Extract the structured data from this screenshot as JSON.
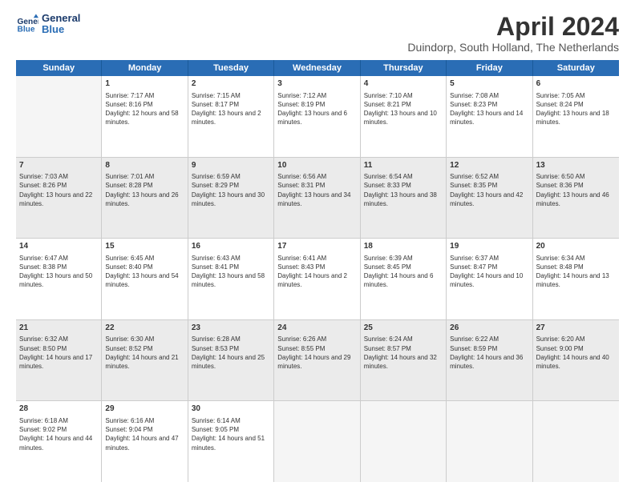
{
  "header": {
    "logo_line1": "General",
    "logo_line2": "Blue",
    "title": "April 2024",
    "subtitle": "Duindorp, South Holland, The Netherlands"
  },
  "calendar": {
    "days_of_week": [
      "Sunday",
      "Monday",
      "Tuesday",
      "Wednesday",
      "Thursday",
      "Friday",
      "Saturday"
    ],
    "weeks": [
      [
        {
          "day": "",
          "sunrise": "",
          "sunset": "",
          "daylight": ""
        },
        {
          "day": "1",
          "sunrise": "Sunrise: 7:17 AM",
          "sunset": "Sunset: 8:16 PM",
          "daylight": "Daylight: 12 hours and 58 minutes."
        },
        {
          "day": "2",
          "sunrise": "Sunrise: 7:15 AM",
          "sunset": "Sunset: 8:17 PM",
          "daylight": "Daylight: 13 hours and 2 minutes."
        },
        {
          "day": "3",
          "sunrise": "Sunrise: 7:12 AM",
          "sunset": "Sunset: 8:19 PM",
          "daylight": "Daylight: 13 hours and 6 minutes."
        },
        {
          "day": "4",
          "sunrise": "Sunrise: 7:10 AM",
          "sunset": "Sunset: 8:21 PM",
          "daylight": "Daylight: 13 hours and 10 minutes."
        },
        {
          "day": "5",
          "sunrise": "Sunrise: 7:08 AM",
          "sunset": "Sunset: 8:23 PM",
          "daylight": "Daylight: 13 hours and 14 minutes."
        },
        {
          "day": "6",
          "sunrise": "Sunrise: 7:05 AM",
          "sunset": "Sunset: 8:24 PM",
          "daylight": "Daylight: 13 hours and 18 minutes."
        }
      ],
      [
        {
          "day": "7",
          "sunrise": "Sunrise: 7:03 AM",
          "sunset": "Sunset: 8:26 PM",
          "daylight": "Daylight: 13 hours and 22 minutes."
        },
        {
          "day": "8",
          "sunrise": "Sunrise: 7:01 AM",
          "sunset": "Sunset: 8:28 PM",
          "daylight": "Daylight: 13 hours and 26 minutes."
        },
        {
          "day": "9",
          "sunrise": "Sunrise: 6:59 AM",
          "sunset": "Sunset: 8:29 PM",
          "daylight": "Daylight: 13 hours and 30 minutes."
        },
        {
          "day": "10",
          "sunrise": "Sunrise: 6:56 AM",
          "sunset": "Sunset: 8:31 PM",
          "daylight": "Daylight: 13 hours and 34 minutes."
        },
        {
          "day": "11",
          "sunrise": "Sunrise: 6:54 AM",
          "sunset": "Sunset: 8:33 PM",
          "daylight": "Daylight: 13 hours and 38 minutes."
        },
        {
          "day": "12",
          "sunrise": "Sunrise: 6:52 AM",
          "sunset": "Sunset: 8:35 PM",
          "daylight": "Daylight: 13 hours and 42 minutes."
        },
        {
          "day": "13",
          "sunrise": "Sunrise: 6:50 AM",
          "sunset": "Sunset: 8:36 PM",
          "daylight": "Daylight: 13 hours and 46 minutes."
        }
      ],
      [
        {
          "day": "14",
          "sunrise": "Sunrise: 6:47 AM",
          "sunset": "Sunset: 8:38 PM",
          "daylight": "Daylight: 13 hours and 50 minutes."
        },
        {
          "day": "15",
          "sunrise": "Sunrise: 6:45 AM",
          "sunset": "Sunset: 8:40 PM",
          "daylight": "Daylight: 13 hours and 54 minutes."
        },
        {
          "day": "16",
          "sunrise": "Sunrise: 6:43 AM",
          "sunset": "Sunset: 8:41 PM",
          "daylight": "Daylight: 13 hours and 58 minutes."
        },
        {
          "day": "17",
          "sunrise": "Sunrise: 6:41 AM",
          "sunset": "Sunset: 8:43 PM",
          "daylight": "Daylight: 14 hours and 2 minutes."
        },
        {
          "day": "18",
          "sunrise": "Sunrise: 6:39 AM",
          "sunset": "Sunset: 8:45 PM",
          "daylight": "Daylight: 14 hours and 6 minutes."
        },
        {
          "day": "19",
          "sunrise": "Sunrise: 6:37 AM",
          "sunset": "Sunset: 8:47 PM",
          "daylight": "Daylight: 14 hours and 10 minutes."
        },
        {
          "day": "20",
          "sunrise": "Sunrise: 6:34 AM",
          "sunset": "Sunset: 8:48 PM",
          "daylight": "Daylight: 14 hours and 13 minutes."
        }
      ],
      [
        {
          "day": "21",
          "sunrise": "Sunrise: 6:32 AM",
          "sunset": "Sunset: 8:50 PM",
          "daylight": "Daylight: 14 hours and 17 minutes."
        },
        {
          "day": "22",
          "sunrise": "Sunrise: 6:30 AM",
          "sunset": "Sunset: 8:52 PM",
          "daylight": "Daylight: 14 hours and 21 minutes."
        },
        {
          "day": "23",
          "sunrise": "Sunrise: 6:28 AM",
          "sunset": "Sunset: 8:53 PM",
          "daylight": "Daylight: 14 hours and 25 minutes."
        },
        {
          "day": "24",
          "sunrise": "Sunrise: 6:26 AM",
          "sunset": "Sunset: 8:55 PM",
          "daylight": "Daylight: 14 hours and 29 minutes."
        },
        {
          "day": "25",
          "sunrise": "Sunrise: 6:24 AM",
          "sunset": "Sunset: 8:57 PM",
          "daylight": "Daylight: 14 hours and 32 minutes."
        },
        {
          "day": "26",
          "sunrise": "Sunrise: 6:22 AM",
          "sunset": "Sunset: 8:59 PM",
          "daylight": "Daylight: 14 hours and 36 minutes."
        },
        {
          "day": "27",
          "sunrise": "Sunrise: 6:20 AM",
          "sunset": "Sunset: 9:00 PM",
          "daylight": "Daylight: 14 hours and 40 minutes."
        }
      ],
      [
        {
          "day": "28",
          "sunrise": "Sunrise: 6:18 AM",
          "sunset": "Sunset: 9:02 PM",
          "daylight": "Daylight: 14 hours and 44 minutes."
        },
        {
          "day": "29",
          "sunrise": "Sunrise: 6:16 AM",
          "sunset": "Sunset: 9:04 PM",
          "daylight": "Daylight: 14 hours and 47 minutes."
        },
        {
          "day": "30",
          "sunrise": "Sunrise: 6:14 AM",
          "sunset": "Sunset: 9:05 PM",
          "daylight": "Daylight: 14 hours and 51 minutes."
        },
        {
          "day": "",
          "sunrise": "",
          "sunset": "",
          "daylight": ""
        },
        {
          "day": "",
          "sunrise": "",
          "sunset": "",
          "daylight": ""
        },
        {
          "day": "",
          "sunrise": "",
          "sunset": "",
          "daylight": ""
        },
        {
          "day": "",
          "sunrise": "",
          "sunset": "",
          "daylight": ""
        }
      ]
    ]
  }
}
